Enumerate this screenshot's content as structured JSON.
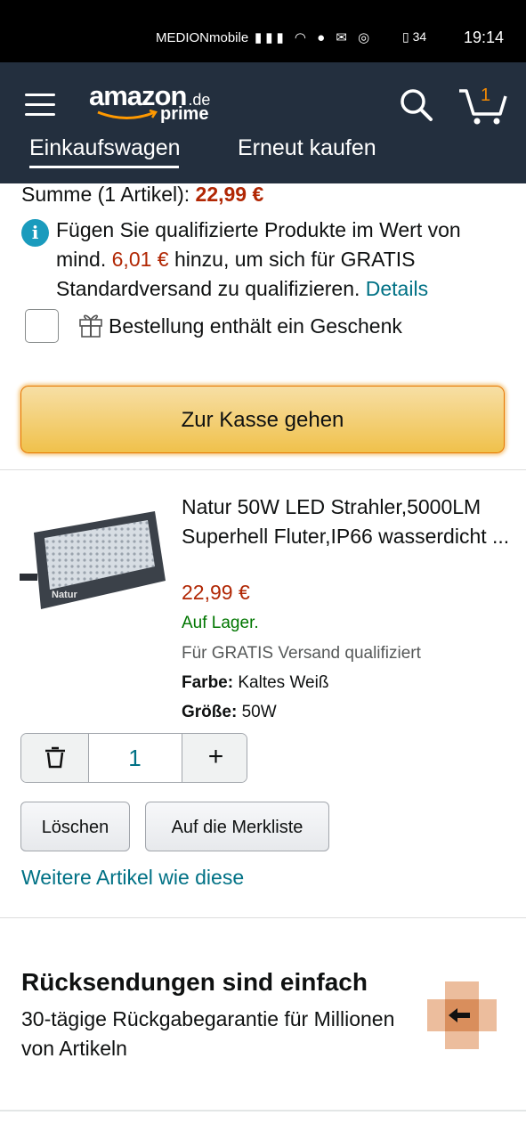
{
  "status": {
    "carrier": "MEDIONmobile",
    "battery": "34",
    "time": "19:14"
  },
  "header": {
    "logo_text": "amazon",
    "logo_domain": ".de",
    "logo_sub": "prime",
    "cart_count": "1",
    "tabs": [
      {
        "label": "Einkaufswagen",
        "active": true
      },
      {
        "label": "Erneut kaufen",
        "active": false
      }
    ]
  },
  "summary": {
    "label": "Summe (1 Artikel):",
    "total": "22,99 €"
  },
  "info": {
    "before": "Fügen Sie qualifizierte Produkte im Wert von mind.",
    "amount": "6,01 €",
    "after": "hinzu, um sich für GRATIS Standardversand zu qualifizieren.",
    "link": "Details"
  },
  "gift": {
    "label": "Bestellung enthält ein Geschenk"
  },
  "checkout": {
    "label": "Zur Kasse gehen"
  },
  "product": {
    "image_label": "Natur",
    "title": "Natur 50W LED Strahler,5000LM Superhell Fluter,IP66 wasserdicht ...",
    "price": "22,99 €",
    "stock": "Auf Lager.",
    "shipping": "Für GRATIS Versand qualifiziert",
    "attr_color_label": "Farbe:",
    "attr_color_value": "Kaltes Weiß",
    "attr_size_label": "Größe:",
    "attr_size_value": "50W",
    "quantity": "1",
    "plus": "+"
  },
  "actions": {
    "delete": "Löschen",
    "save": "Auf die Merkliste",
    "more_like": "Weitere Artikel wie diese"
  },
  "returns": {
    "title": "Rücksendungen sind einfach",
    "text": "30-tägige Rückgabegarantie für Millionen von Artikeln"
  },
  "colors": {
    "header_bg": "#232f3e",
    "price": "#b12704",
    "link": "#007185",
    "stock": "#007600",
    "checkout": "#f0c14b"
  }
}
